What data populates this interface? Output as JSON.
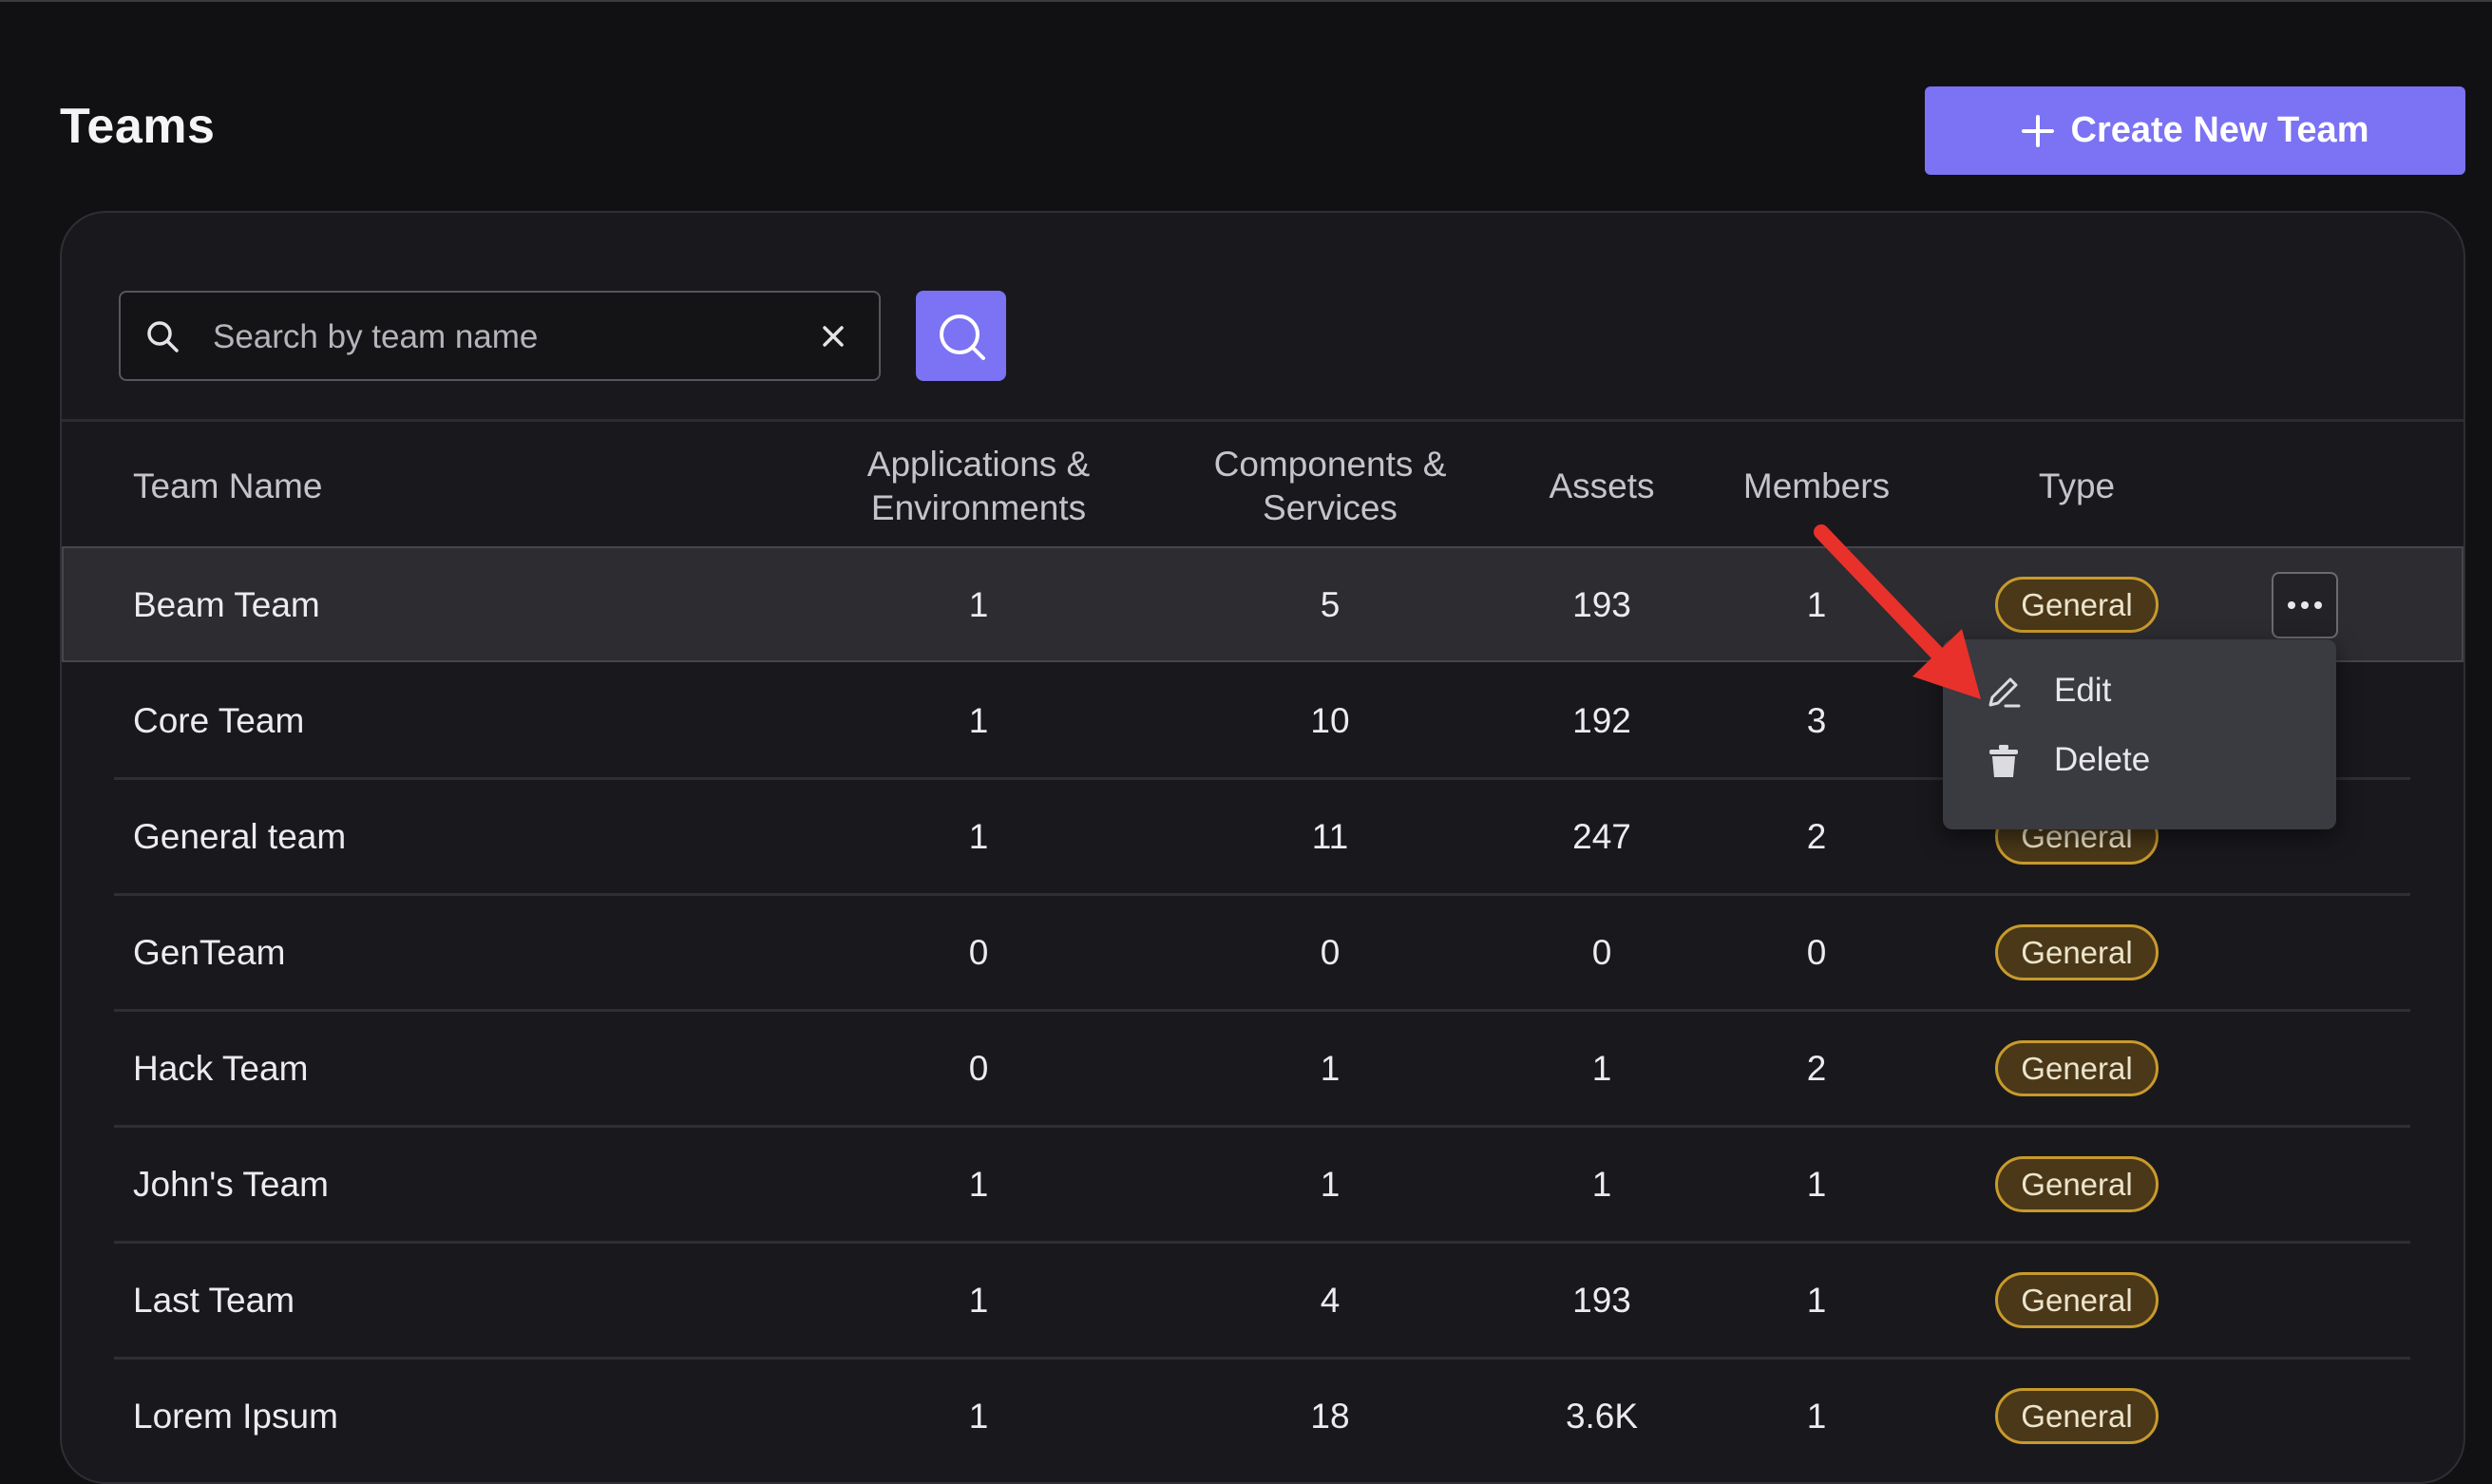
{
  "page": {
    "title": "Teams"
  },
  "toolbar": {
    "create_label": "Create New Team"
  },
  "search": {
    "placeholder": "Search by team name",
    "value": ""
  },
  "table": {
    "columns": {
      "name": "Team Name",
      "apps_line1": "Applications &",
      "apps_line2": "Environments",
      "comps_line1": "Components &",
      "comps_line2": "Services",
      "assets": "Assets",
      "members": "Members",
      "type": "Type"
    },
    "rows": [
      {
        "name": "Beam Team",
        "apps": "1",
        "components": "5",
        "assets": "193",
        "members": "1",
        "type": "General"
      },
      {
        "name": "Core Team",
        "apps": "1",
        "components": "10",
        "assets": "192",
        "members": "3",
        "type": "General"
      },
      {
        "name": "General team",
        "apps": "1",
        "components": "11",
        "assets": "247",
        "members": "2",
        "type": "General"
      },
      {
        "name": "GenTeam",
        "apps": "0",
        "components": "0",
        "assets": "0",
        "members": "0",
        "type": "General"
      },
      {
        "name": "Hack Team",
        "apps": "0",
        "components": "1",
        "assets": "1",
        "members": "2",
        "type": "General"
      },
      {
        "name": "John's Team",
        "apps": "1",
        "components": "1",
        "assets": "1",
        "members": "1",
        "type": "General"
      },
      {
        "name": "Last Team",
        "apps": "1",
        "components": "4",
        "assets": "193",
        "members": "1",
        "type": "General"
      },
      {
        "name": "Lorem Ipsum",
        "apps": "1",
        "components": "18",
        "assets": "3.6K",
        "members": "1",
        "type": "General"
      }
    ]
  },
  "row_menu": {
    "edit_label": "Edit",
    "delete_label": "Delete"
  },
  "colors": {
    "accent": "#7b72f4",
    "badge_border": "#c89a2c",
    "annotation_arrow": "#e8312a"
  }
}
